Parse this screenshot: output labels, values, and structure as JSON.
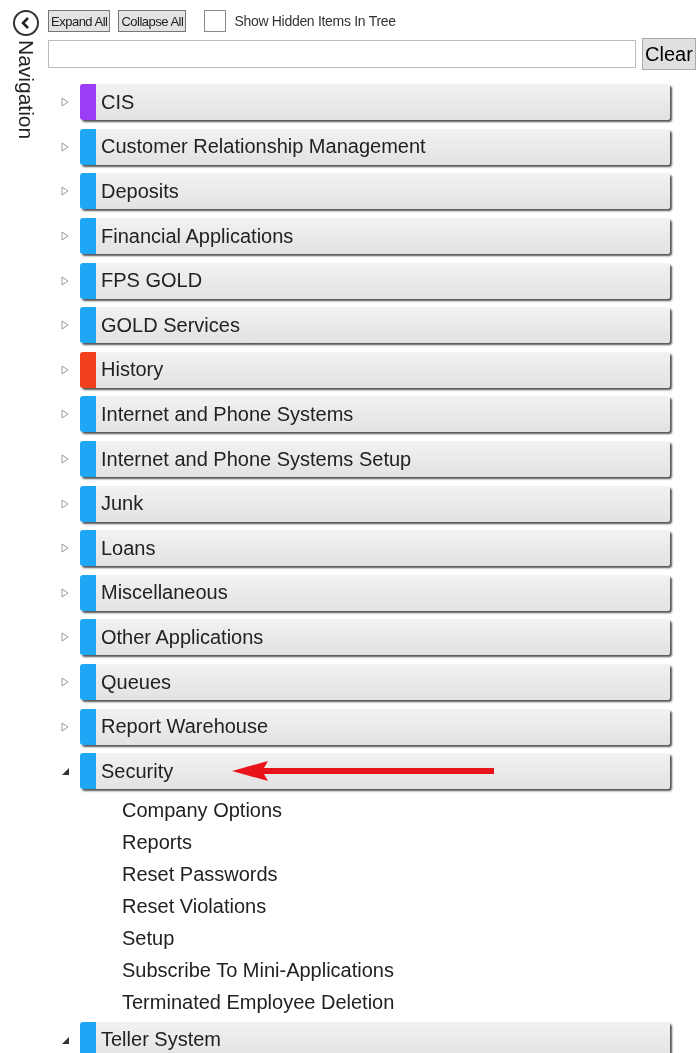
{
  "toolbar": {
    "expand_all": "Expand All",
    "collapse_all": "Collapse All",
    "show_hidden": {
      "label": "Show Hidden Items In Tree",
      "checked": false
    }
  },
  "side_title": "Navigation",
  "search": {
    "clear": "Clear"
  },
  "tree": [
    {
      "label": "CIS",
      "color": "#9b3cf6",
      "expanded": false
    },
    {
      "label": "Customer Relationship Management",
      "color": "#1ea7f5",
      "expanded": false
    },
    {
      "label": "Deposits",
      "color": "#1ea7f5",
      "expanded": false
    },
    {
      "label": "Financial Applications",
      "color": "#1ea7f5",
      "expanded": false
    },
    {
      "label": "FPS GOLD",
      "color": "#1ea7f5",
      "expanded": false
    },
    {
      "label": "GOLD Services",
      "color": "#1ea7f5",
      "expanded": false
    },
    {
      "label": "History",
      "color": "#f2401c",
      "expanded": false
    },
    {
      "label": "Internet and Phone Systems",
      "color": "#1ea7f5",
      "expanded": false
    },
    {
      "label": "Internet and Phone Systems Setup",
      "color": "#1ea7f5",
      "expanded": false
    },
    {
      "label": "Junk",
      "color": "#1ea7f5",
      "expanded": false
    },
    {
      "label": "Loans",
      "color": "#1ea7f5",
      "expanded": false
    },
    {
      "label": "Miscellaneous",
      "color": "#1ea7f5",
      "expanded": false
    },
    {
      "label": "Other Applications",
      "color": "#1ea7f5",
      "expanded": false
    },
    {
      "label": "Queues",
      "color": "#1ea7f5",
      "expanded": false
    },
    {
      "label": "Report Warehouse",
      "color": "#1ea7f5",
      "expanded": false
    },
    {
      "label": "Security",
      "color": "#1ea7f5",
      "expanded": true,
      "pointer": true,
      "children": [
        {
          "label": "Company Options"
        },
        {
          "label": "Reports"
        },
        {
          "label": "Reset Passwords"
        },
        {
          "label": "Reset Violations"
        },
        {
          "label": "Setup"
        },
        {
          "label": "Subscribe To Mini-Applications"
        },
        {
          "label": "Terminated Employee Deletion"
        }
      ]
    },
    {
      "label": "Teller System",
      "color": "#1ea7f5",
      "expanded": true
    }
  ]
}
